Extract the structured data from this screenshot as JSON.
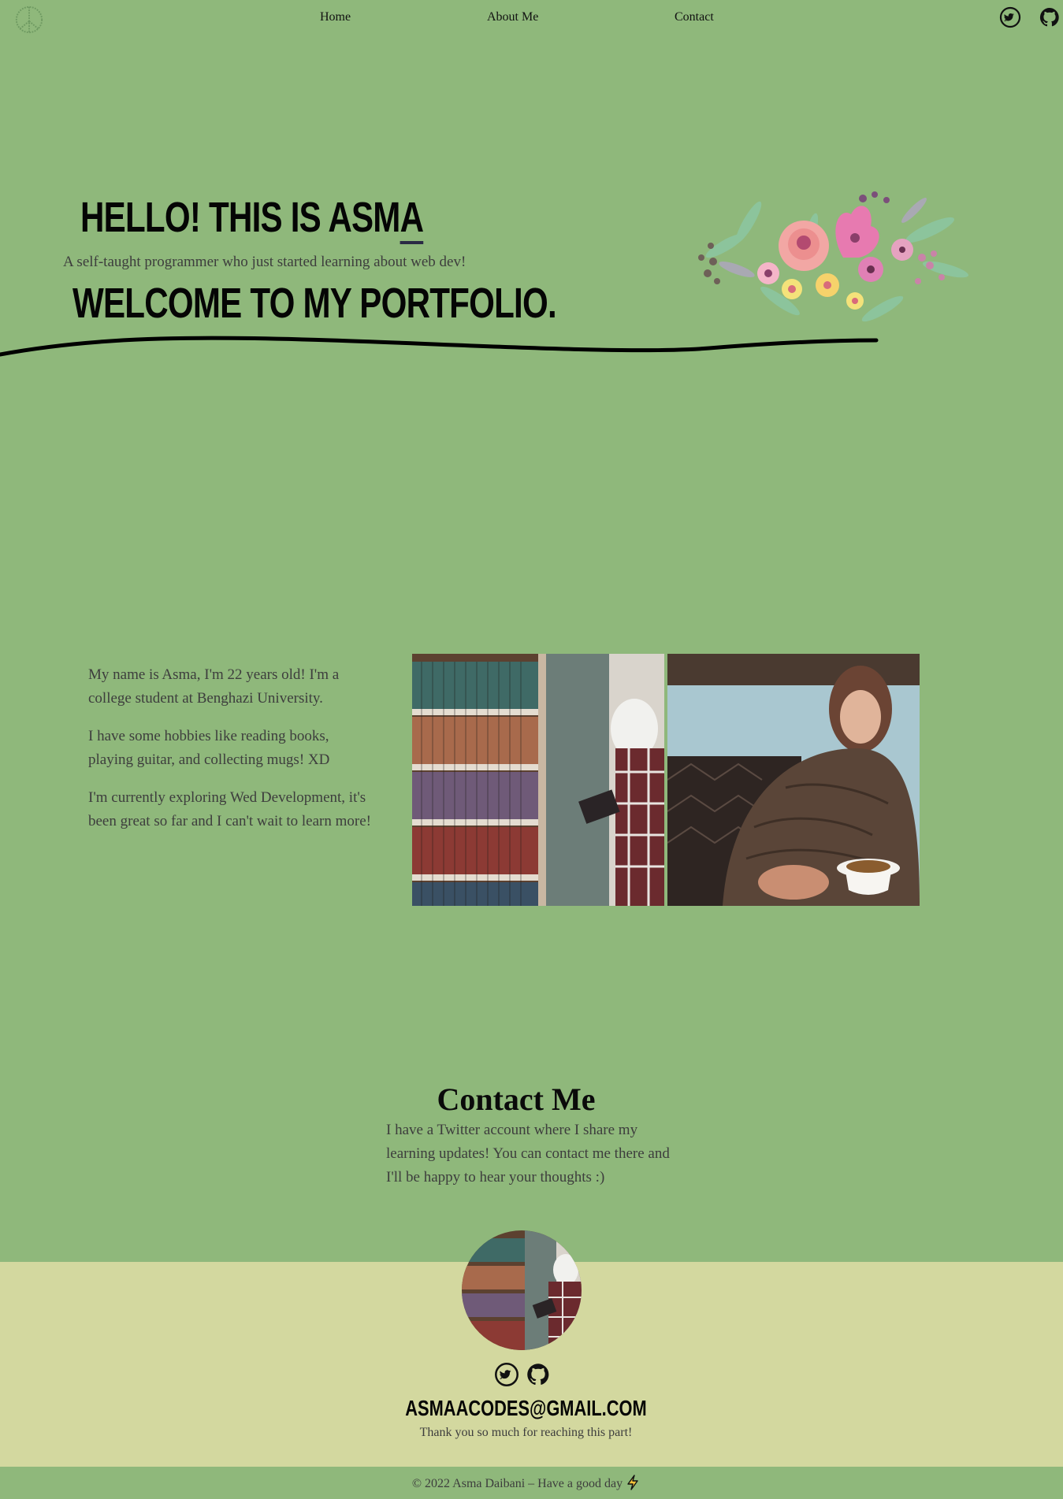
{
  "nav": {
    "home": "Home",
    "about": "About Me",
    "contact": "Contact"
  },
  "hero": {
    "title_main": "HELLO! THIS IS ASM",
    "title_last": "A",
    "subtitle": "A self-taught programmer who just started learning about web dev!",
    "welcome": "WELCOME TO MY PORTFOLIO."
  },
  "about": {
    "paragraphs": [
      "My name is Asma, I'm 22 years old! I'm a college student at Benghazi University.",
      "I have some hobbies like reading books, playing guitar, and collecting mugs! XD",
      "I'm currently exploring Wed Development, it's been great so far and I can't wait to learn more!"
    ]
  },
  "contact": {
    "title": "Contact Me",
    "text": "I have a Twitter account where I share my learning updates! You can contact me there and I'll be happy to hear your thoughts :)"
  },
  "footer": {
    "email": "ASMAACODES@GMAIL.COM",
    "thanks": "Thank you so much for reaching this part!",
    "copyright": "© 2022 Asma Daibani – Have a good day"
  },
  "icons": {
    "logo": "peace-icon",
    "twitter": "twitter-icon",
    "github": "github-icon",
    "bolt": "lightning-icon"
  },
  "colors": {
    "background": "#8fb87b",
    "band": "#d3d89f",
    "text": "#3d3d3d",
    "heading": "#050505"
  }
}
